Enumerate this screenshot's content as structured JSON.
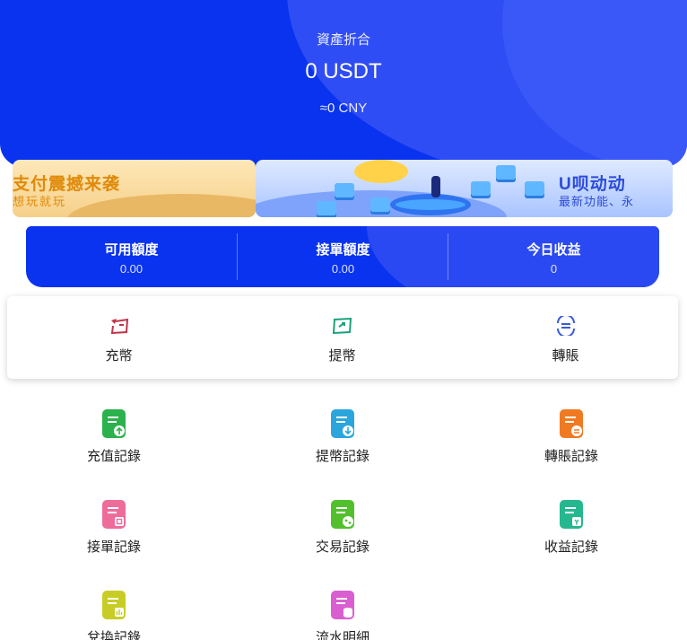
{
  "header": {
    "asset_label": "資產折合",
    "asset_value": "0 USDT",
    "asset_cny": "≈0 CNY"
  },
  "banners": [
    {
      "title": "支付震撼来袭",
      "subtitle": "想玩就玩"
    },
    {
      "title": "U呗动动",
      "subtitle": "最新功能、永"
    }
  ],
  "stats": [
    {
      "label": "可用額度",
      "value": "0.00"
    },
    {
      "label": "接單額度",
      "value": "0.00"
    },
    {
      "label": "今日收益",
      "value": "0"
    }
  ],
  "actions": [
    {
      "label": "充幣",
      "icon": "deposit-icon",
      "color": "#c0354a"
    },
    {
      "label": "提幣",
      "icon": "withdraw-icon",
      "color": "#1aa37a"
    },
    {
      "label": "轉賬",
      "icon": "transfer-icon",
      "color": "#3a5bd9"
    }
  ],
  "records": [
    {
      "label": "充值記錄",
      "icon": "recharge-record-icon",
      "color": "#2bb24c"
    },
    {
      "label": "提幣記錄",
      "icon": "withdraw-record-icon",
      "color": "#2aa6dc"
    },
    {
      "label": "轉賬記錄",
      "icon": "transfer-record-icon",
      "color": "#f07a22"
    },
    {
      "label": "接單記錄",
      "icon": "order-record-icon",
      "color": "#ee6c9a"
    },
    {
      "label": "交易記錄",
      "icon": "trade-record-icon",
      "color": "#52c02c"
    },
    {
      "label": "收益記錄",
      "icon": "income-record-icon",
      "color": "#25b88e"
    },
    {
      "label": "兌換記錄",
      "icon": "exchange-record-icon",
      "color": "#c8cd25"
    },
    {
      "label": "流水明細",
      "icon": "ledger-detail-icon",
      "color": "#d95fd0"
    }
  ]
}
